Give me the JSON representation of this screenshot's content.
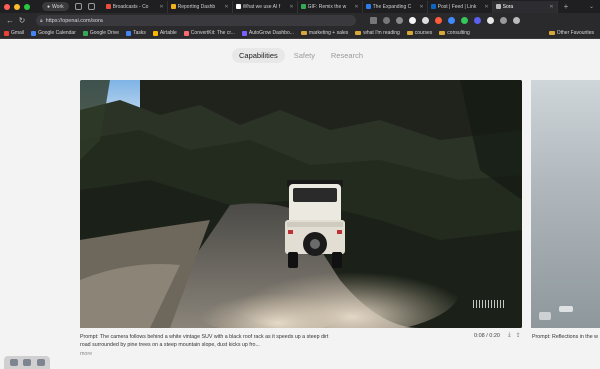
{
  "browser": {
    "profile": "Work",
    "tabs": [
      {
        "label": "Broadcasts - Co",
        "color": "#e84d3d"
      },
      {
        "label": "Reporting Dashb",
        "color": "#f2b01e"
      },
      {
        "label": "What we use AI f",
        "color": "#ffffff"
      },
      {
        "label": "GIF: Remix the w",
        "color": "#34a853"
      },
      {
        "label": "The Expanding C",
        "color": "#2b7de9"
      },
      {
        "label": "Post | Feed | Link",
        "color": "#0a66c2"
      },
      {
        "label": "Sora",
        "color": "#bbbbbb"
      }
    ],
    "url": "https://openai.com/sora",
    "bookmarks": [
      {
        "label": "Gmail",
        "color": "#ea4335",
        "kind": "icon"
      },
      {
        "label": "Google Calendar",
        "color": "#4285f4",
        "kind": "icon"
      },
      {
        "label": "Google Drive",
        "color": "#34a853",
        "kind": "icon"
      },
      {
        "label": "Tasks",
        "color": "#4285f4",
        "kind": "icon"
      },
      {
        "label": "Airtable",
        "color": "#fcb400",
        "kind": "icon"
      },
      {
        "label": "ConvertKit: The cr...",
        "color": "#fb6970",
        "kind": "icon"
      },
      {
        "label": "AutoGrow Dashbo...",
        "color": "#7b61ff",
        "kind": "icon"
      },
      {
        "label": "marketing + sales",
        "color": "#d7a93a",
        "kind": "folder"
      },
      {
        "label": "what I'm reading",
        "color": "#d7a93a",
        "kind": "folder"
      },
      {
        "label": "courses",
        "color": "#d7a93a",
        "kind": "folder"
      },
      {
        "label": "consulting",
        "color": "#d7a93a",
        "kind": "folder"
      }
    ],
    "bookmarks_right": "Other Favourites"
  },
  "page": {
    "nav": [
      "Capabilities",
      "Safety",
      "Research"
    ],
    "active_nav": "Capabilities",
    "video": {
      "caption": "Prompt: The camera follows behind a white vintage SUV with a black roof rack as it speeds up a steep dirt road surrounded by pine trees on a steep mountain slope, dust kicks up fro...",
      "more": "more",
      "timecode": "0:08 / 0:20",
      "icons": [
        "download-icon",
        "share-icon"
      ]
    },
    "next_video": {
      "caption": "Prompt: Reflections in the w"
    }
  }
}
